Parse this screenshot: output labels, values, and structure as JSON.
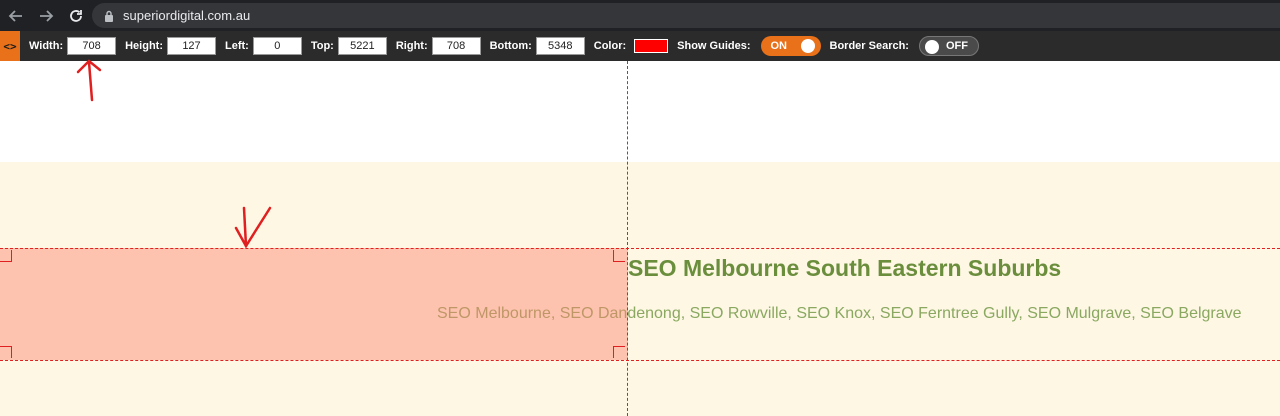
{
  "browser": {
    "url": "superiordigital.com.au"
  },
  "ruler_toolbar": {
    "logo": "<>",
    "fields": [
      {
        "label": "Width:",
        "value": "708"
      },
      {
        "label": "Height:",
        "value": "127"
      },
      {
        "label": "Left:",
        "value": "0"
      },
      {
        "label": "Top:",
        "value": "5221"
      },
      {
        "label": "Right:",
        "value": "708"
      },
      {
        "label": "Bottom:",
        "value": "5348"
      }
    ],
    "color_label": "Color:",
    "color_value": "#ff0000",
    "show_guides_label": "Show Guides:",
    "show_guides_state": "ON",
    "border_search_label": "Border Search:",
    "border_search_state": "OFF"
  },
  "page": {
    "heading": "SEO Melbourne South Eastern Suburbs",
    "links": [
      "SEO Melbourne",
      "SEO Dandenong",
      "SEO Rowville",
      "SEO Knox",
      "SEO Ferntree Gully",
      "SEO Mulgrave",
      "SEO Belgrave"
    ],
    "separator": ", "
  },
  "colors": {
    "accent_orange": "#e8711a",
    "guide_red": "#e02020",
    "heading_green": "#6b8e3d",
    "link_green": "#8aa860",
    "cream_bg": "#fdf7e4"
  }
}
